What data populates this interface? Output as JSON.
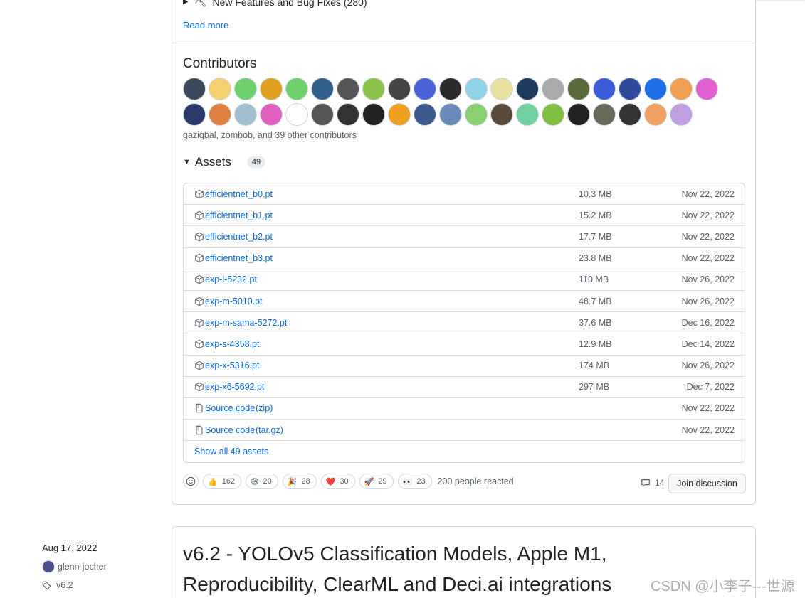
{
  "release_notes": {
    "truncated_heading": "New Features and Bug Fixes (280)",
    "read_more": "Read more"
  },
  "contributors": {
    "title": "Contributors",
    "summary": "gaziqbal, zombob, and 39 other contributors",
    "avatar_colors": [
      "#3a4a5c",
      "#f4d06f",
      "#6ed16e",
      "#e0a020",
      "#6ed16e",
      "#2f5f8a",
      "#555555",
      "#8bc34a",
      "#444444",
      "#4a62d8",
      "#2b2b2b",
      "#8fd3e8",
      "#e8e0a0",
      "#1e3a5f",
      "#aaaaaa",
      "#5a6b3a",
      "#3b5bdb",
      "#2e4a9a",
      "#1f6feb",
      "#f0a050",
      "#e060d0",
      "#2a3a6a",
      "#e08040",
      "#a0c0d0",
      "#e060c0",
      "#ffffff",
      "#555555",
      "#333333",
      "#222222",
      "#f0a020",
      "#3a5a8a",
      "#6a8aba",
      "#8ad070",
      "#5a4a3a",
      "#70d0a0",
      "#80c040",
      "#222222",
      "#6a6a5a",
      "#333333",
      "#f0a060",
      "#c0a0e0"
    ]
  },
  "assets": {
    "title": "Assets",
    "count": "49",
    "rows": [
      {
        "name": "efficientnet_b0.pt",
        "ext": "",
        "size": "10.3 MB",
        "date": "Nov 22, 2022",
        "icon": "package-icon"
      },
      {
        "name": "efficientnet_b1.pt",
        "ext": "",
        "size": "15.2 MB",
        "date": "Nov 22, 2022",
        "icon": "package-icon"
      },
      {
        "name": "efficientnet_b2.pt",
        "ext": "",
        "size": "17.7 MB",
        "date": "Nov 22, 2022",
        "icon": "package-icon"
      },
      {
        "name": "efficientnet_b3.pt",
        "ext": "",
        "size": "23.8 MB",
        "date": "Nov 22, 2022",
        "icon": "package-icon"
      },
      {
        "name": "exp-l-5232.pt",
        "ext": "",
        "size": "110 MB",
        "date": "Nov 26, 2022",
        "icon": "package-icon"
      },
      {
        "name": "exp-m-5010.pt",
        "ext": "",
        "size": "48.7 MB",
        "date": "Nov 26, 2022",
        "icon": "package-icon"
      },
      {
        "name": "exp-m-sama-5272.pt",
        "ext": "",
        "size": "37.6 MB",
        "date": "Dec 16, 2022",
        "icon": "package-icon"
      },
      {
        "name": "exp-s-4358.pt",
        "ext": "",
        "size": "12.9 MB",
        "date": "Dec 14, 2022",
        "icon": "package-icon"
      },
      {
        "name": "exp-x-5316.pt",
        "ext": "",
        "size": "174 MB",
        "date": "Nov 26, 2022",
        "icon": "package-icon"
      },
      {
        "name": "exp-x6-5692.pt",
        "ext": "",
        "size": "297 MB",
        "date": "Dec 7, 2022",
        "icon": "package-icon"
      },
      {
        "name": "Source code",
        "ext": "(zip)",
        "size": "",
        "date": "Nov 22, 2022",
        "icon": "file-zip-icon"
      },
      {
        "name": "Source code",
        "ext": "(tar.gz)",
        "size": "",
        "date": "Nov 22, 2022",
        "icon": "file-zip-icon"
      }
    ],
    "show_all": "Show all 49 assets"
  },
  "reactions": {
    "items": [
      {
        "emoji": "👍",
        "count": "162",
        "name": "thumbs-up"
      },
      {
        "emoji": "😄",
        "count": "20",
        "name": "laugh"
      },
      {
        "emoji": "🎉",
        "count": "28",
        "name": "hooray"
      },
      {
        "emoji": "❤️",
        "count": "30",
        "name": "heart"
      },
      {
        "emoji": "🚀",
        "count": "29",
        "name": "rocket"
      },
      {
        "emoji": "👀",
        "count": "23",
        "name": "eyes"
      }
    ],
    "summary": "200 people reacted",
    "comment_count": "14",
    "join_label": "Join discussion"
  },
  "next_release": {
    "date": "Aug 17, 2022",
    "author": "glenn-jocher",
    "tag": "v6.2",
    "title": "v6.2 - YOLOv5 Classification Models, Apple M1, Reproducibility, ClearML and Deci.ai integrations"
  },
  "watermark": "CSDN @小李子---世源"
}
